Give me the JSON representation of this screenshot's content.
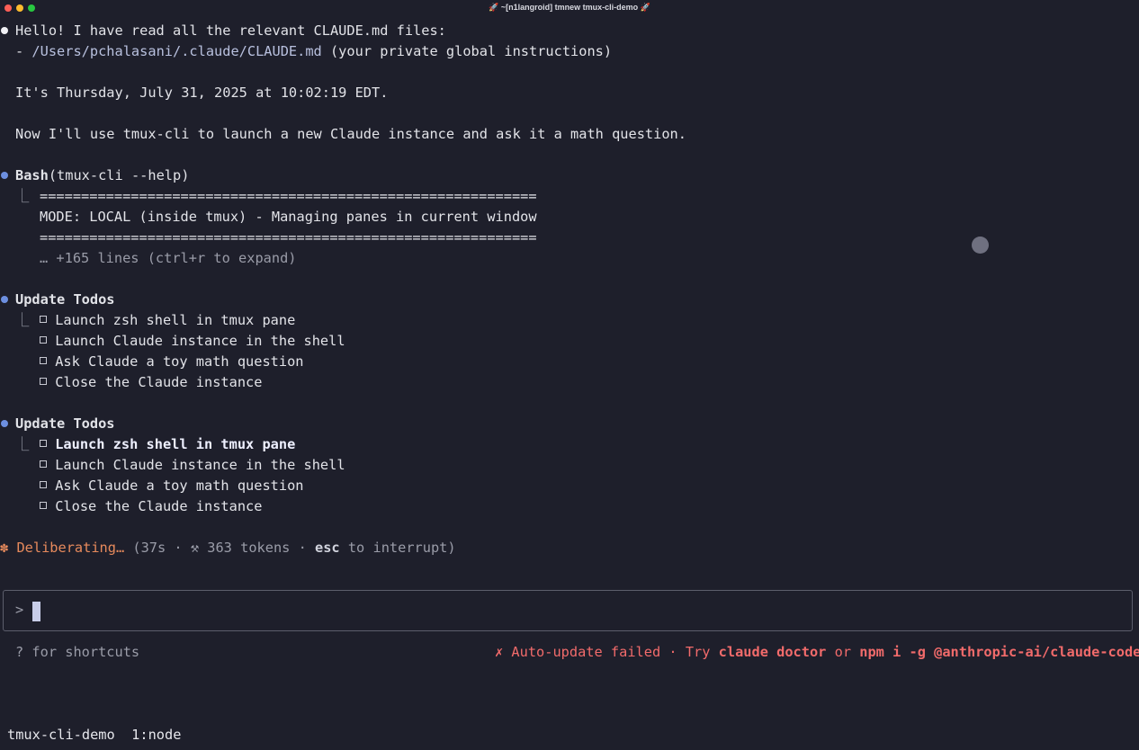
{
  "window": {
    "title": "🚀 ~[n1langroid] tmnew tmux-cli-demo 🚀"
  },
  "messages": {
    "greeting": "Hello! I have read all the relevant CLAUDE.md files:",
    "file_dash": "- ",
    "file_path": "/Users/pchalasani/.claude/CLAUDE.md",
    "file_note": " (your private global instructions)",
    "date": "It's Thursday, July 31, 2025 at 10:02:19 EDT.",
    "plan": "Now I'll use tmux-cli to launch a new Claude instance and ask it a math question."
  },
  "bash": {
    "tool": "Bash",
    "args": "(tmux-cli --help)",
    "corner": "⎿",
    "rule": "============================================================",
    "mode": "MODE: LOCAL (inside tmux) - Managing panes in current window",
    "more": "… +165 lines (ctrl+r to expand)"
  },
  "todos1": {
    "title": "Update Todos",
    "items": [
      "Launch zsh shell in tmux pane",
      "Launch Claude instance in the shell",
      "Ask Claude a toy math question",
      "Close the Claude instance"
    ]
  },
  "todos2": {
    "title": "Update Todos",
    "items": [
      "Launch zsh shell in tmux pane",
      "Launch Claude instance in the shell",
      "Ask Claude a toy math question",
      "Close the Claude instance"
    ]
  },
  "status_line": {
    "icon": "✽",
    "state": "Deliberating…",
    "detail_a": " (37s · ⚒ 363 tokens · ",
    "key": "esc",
    "detail_b": " to interrupt)"
  },
  "input": {
    "prompt": ">",
    "value": ""
  },
  "footer": {
    "shortcuts": "? for shortcuts",
    "update_a": "✗ Auto-update failed · Try ",
    "cmd1": "claude doctor",
    "or": " or ",
    "cmd2": "npm i -g @anthropic-ai/claude-code"
  },
  "tmux": {
    "session": "tmux-cli-demo",
    "window": "1:node"
  },
  "colors": {
    "background": "#1e1f2b",
    "accent_blue": "#6d8fe0",
    "orange": "#e78a5c",
    "error_red": "#f26b6b"
  }
}
